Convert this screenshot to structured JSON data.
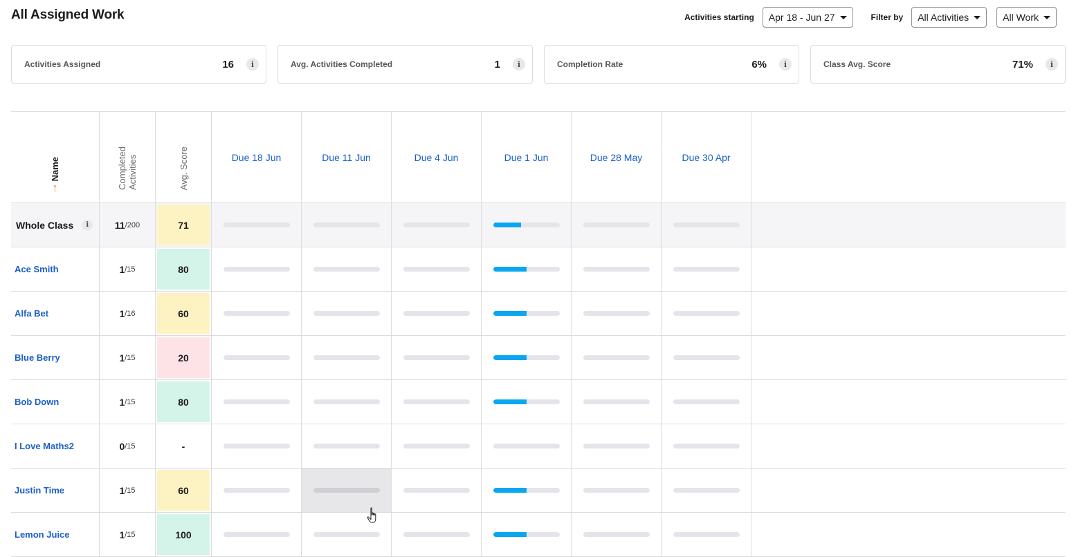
{
  "header": {
    "title": "All Assigned Work"
  },
  "filters": {
    "activities_starting_label": "Activities starting",
    "date_range": "Apr 18 - Jun 27",
    "filter_by_label": "Filter by",
    "activities_filter": "All Activities",
    "work_filter": "All Work"
  },
  "stats": [
    {
      "label": "Activities Assigned",
      "value": "16"
    },
    {
      "label": "Avg. Activities Completed",
      "value": "1"
    },
    {
      "label": "Completion Rate",
      "value": "6%"
    },
    {
      "label": "Class Avg. Score",
      "value": "71%"
    }
  ],
  "info_glyph": "i",
  "table": {
    "headers": {
      "name": "Name",
      "completed_line1": "Completed",
      "completed_line2": "Activities",
      "avg_score": "Avg. Score",
      "due": [
        "Due 18 Jun",
        "Due 11 Jun",
        "Due 4 Jun",
        "Due 1 Jun",
        "Due 28 May",
        "Due 30 Apr"
      ]
    },
    "sort_arrow": "↑",
    "whole_class": {
      "name": "Whole Class",
      "completed": "11",
      "total": "/200",
      "score": "71",
      "progress": [
        0,
        0,
        0,
        0.42,
        0,
        0
      ]
    },
    "students": [
      {
        "name": "Ace Smith",
        "completed": "1",
        "total": "/15",
        "score": "80",
        "progress": [
          0,
          0,
          0,
          0.5,
          0,
          0
        ]
      },
      {
        "name": "Alfa Bet",
        "completed": "1",
        "total": "/16",
        "score": "60",
        "progress": [
          0,
          0,
          0,
          0.5,
          0,
          0
        ]
      },
      {
        "name": "Blue Berry",
        "completed": "1",
        "total": "/15",
        "score": "20",
        "progress": [
          0,
          0,
          0,
          0.5,
          0,
          0
        ]
      },
      {
        "name": "Bob Down",
        "completed": "1",
        "total": "/15",
        "score": "80",
        "progress": [
          0,
          0,
          0,
          0.5,
          0,
          0
        ]
      },
      {
        "name": "I Love Maths2",
        "completed": "0",
        "total": "/15",
        "score": "-",
        "progress": [
          0,
          0,
          0,
          0,
          0,
          0
        ]
      },
      {
        "name": "Justin Time",
        "completed": "1",
        "total": "/15",
        "score": "60",
        "progress": [
          0,
          0,
          0,
          0.5,
          0,
          0
        ]
      },
      {
        "name": "Lemon Juice",
        "completed": "1",
        "total": "/15",
        "score": "100",
        "progress": [
          0,
          0,
          0,
          0.5,
          0,
          0
        ]
      }
    ]
  },
  "colors": {
    "score_high": "#d4f3e9",
    "score_mid": "#fdf3c2",
    "score_low": "#fde3e6",
    "progress_fill": "#0aa6f0",
    "link": "#1a5fc9",
    "sort_arrow": "#e87722"
  }
}
